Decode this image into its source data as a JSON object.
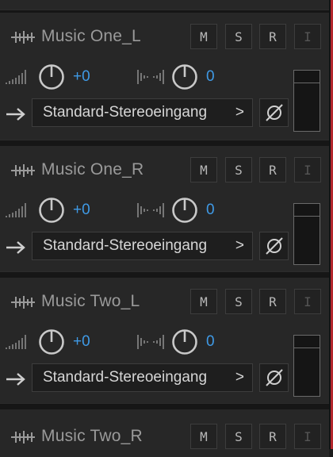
{
  "tracks": [
    {
      "name": "Music One_L",
      "volume": "+0",
      "pan": "0",
      "input": "Standard-Stereoeingang",
      "input_chevron": ">"
    },
    {
      "name": "Music One_R",
      "volume": "+0",
      "pan": "0",
      "input": "Standard-Stereoeingang",
      "input_chevron": ">"
    },
    {
      "name": "Music Two_L",
      "volume": "+0",
      "pan": "0",
      "input": "Standard-Stereoeingang",
      "input_chevron": ">"
    },
    {
      "name": "Music Two_R"
    }
  ],
  "buttons": {
    "mute": "M",
    "solo": "S",
    "record": "R",
    "input_monitor": "I"
  },
  "icons": {
    "track_type": "waveform-icon",
    "volume": "volume-ramp-icon",
    "pan": "pan-bars-icon",
    "input": "right-arrow-icon",
    "phase": "phase-invert-icon"
  },
  "colors": {
    "value_blue": "#3f9ae6",
    "accent_red": "#b3262c"
  }
}
